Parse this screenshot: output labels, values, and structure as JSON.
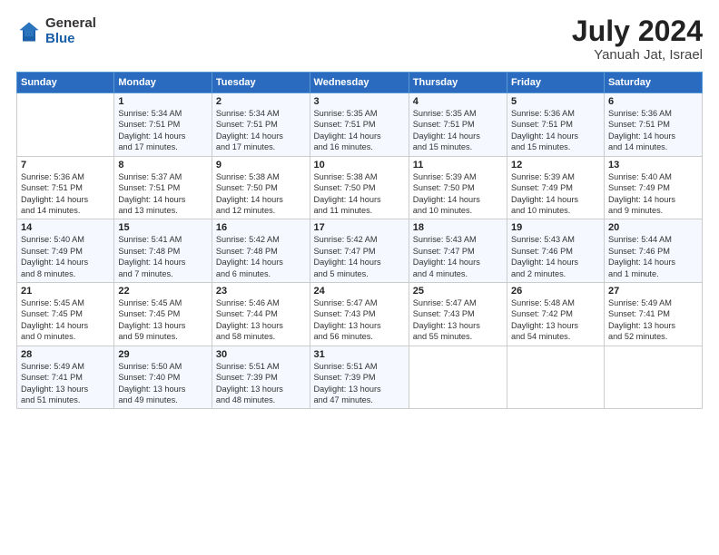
{
  "header": {
    "logo_general": "General",
    "logo_blue": "Blue",
    "title": "July 2024",
    "location": "Yanuah Jat, Israel"
  },
  "days_of_week": [
    "Sunday",
    "Monday",
    "Tuesday",
    "Wednesday",
    "Thursday",
    "Friday",
    "Saturday"
  ],
  "weeks": [
    [
      {
        "day": "",
        "info": ""
      },
      {
        "day": "1",
        "info": "Sunrise: 5:34 AM\nSunset: 7:51 PM\nDaylight: 14 hours\nand 17 minutes."
      },
      {
        "day": "2",
        "info": "Sunrise: 5:34 AM\nSunset: 7:51 PM\nDaylight: 14 hours\nand 17 minutes."
      },
      {
        "day": "3",
        "info": "Sunrise: 5:35 AM\nSunset: 7:51 PM\nDaylight: 14 hours\nand 16 minutes."
      },
      {
        "day": "4",
        "info": "Sunrise: 5:35 AM\nSunset: 7:51 PM\nDaylight: 14 hours\nand 15 minutes."
      },
      {
        "day": "5",
        "info": "Sunrise: 5:36 AM\nSunset: 7:51 PM\nDaylight: 14 hours\nand 15 minutes."
      },
      {
        "day": "6",
        "info": "Sunrise: 5:36 AM\nSunset: 7:51 PM\nDaylight: 14 hours\nand 14 minutes."
      }
    ],
    [
      {
        "day": "7",
        "info": "Sunrise: 5:36 AM\nSunset: 7:51 PM\nDaylight: 14 hours\nand 14 minutes."
      },
      {
        "day": "8",
        "info": "Sunrise: 5:37 AM\nSunset: 7:51 PM\nDaylight: 14 hours\nand 13 minutes."
      },
      {
        "day": "9",
        "info": "Sunrise: 5:38 AM\nSunset: 7:50 PM\nDaylight: 14 hours\nand 12 minutes."
      },
      {
        "day": "10",
        "info": "Sunrise: 5:38 AM\nSunset: 7:50 PM\nDaylight: 14 hours\nand 11 minutes."
      },
      {
        "day": "11",
        "info": "Sunrise: 5:39 AM\nSunset: 7:50 PM\nDaylight: 14 hours\nand 10 minutes."
      },
      {
        "day": "12",
        "info": "Sunrise: 5:39 AM\nSunset: 7:49 PM\nDaylight: 14 hours\nand 10 minutes."
      },
      {
        "day": "13",
        "info": "Sunrise: 5:40 AM\nSunset: 7:49 PM\nDaylight: 14 hours\nand 9 minutes."
      }
    ],
    [
      {
        "day": "14",
        "info": "Sunrise: 5:40 AM\nSunset: 7:49 PM\nDaylight: 14 hours\nand 8 minutes."
      },
      {
        "day": "15",
        "info": "Sunrise: 5:41 AM\nSunset: 7:48 PM\nDaylight: 14 hours\nand 7 minutes."
      },
      {
        "day": "16",
        "info": "Sunrise: 5:42 AM\nSunset: 7:48 PM\nDaylight: 14 hours\nand 6 minutes."
      },
      {
        "day": "17",
        "info": "Sunrise: 5:42 AM\nSunset: 7:47 PM\nDaylight: 14 hours\nand 5 minutes."
      },
      {
        "day": "18",
        "info": "Sunrise: 5:43 AM\nSunset: 7:47 PM\nDaylight: 14 hours\nand 4 minutes."
      },
      {
        "day": "19",
        "info": "Sunrise: 5:43 AM\nSunset: 7:46 PM\nDaylight: 14 hours\nand 2 minutes."
      },
      {
        "day": "20",
        "info": "Sunrise: 5:44 AM\nSunset: 7:46 PM\nDaylight: 14 hours\nand 1 minute."
      }
    ],
    [
      {
        "day": "21",
        "info": "Sunrise: 5:45 AM\nSunset: 7:45 PM\nDaylight: 14 hours\nand 0 minutes."
      },
      {
        "day": "22",
        "info": "Sunrise: 5:45 AM\nSunset: 7:45 PM\nDaylight: 13 hours\nand 59 minutes."
      },
      {
        "day": "23",
        "info": "Sunrise: 5:46 AM\nSunset: 7:44 PM\nDaylight: 13 hours\nand 58 minutes."
      },
      {
        "day": "24",
        "info": "Sunrise: 5:47 AM\nSunset: 7:43 PM\nDaylight: 13 hours\nand 56 minutes."
      },
      {
        "day": "25",
        "info": "Sunrise: 5:47 AM\nSunset: 7:43 PM\nDaylight: 13 hours\nand 55 minutes."
      },
      {
        "day": "26",
        "info": "Sunrise: 5:48 AM\nSunset: 7:42 PM\nDaylight: 13 hours\nand 54 minutes."
      },
      {
        "day": "27",
        "info": "Sunrise: 5:49 AM\nSunset: 7:41 PM\nDaylight: 13 hours\nand 52 minutes."
      }
    ],
    [
      {
        "day": "28",
        "info": "Sunrise: 5:49 AM\nSunset: 7:41 PM\nDaylight: 13 hours\nand 51 minutes."
      },
      {
        "day": "29",
        "info": "Sunrise: 5:50 AM\nSunset: 7:40 PM\nDaylight: 13 hours\nand 49 minutes."
      },
      {
        "day": "30",
        "info": "Sunrise: 5:51 AM\nSunset: 7:39 PM\nDaylight: 13 hours\nand 48 minutes."
      },
      {
        "day": "31",
        "info": "Sunrise: 5:51 AM\nSunset: 7:39 PM\nDaylight: 13 hours\nand 47 minutes."
      },
      {
        "day": "",
        "info": ""
      },
      {
        "day": "",
        "info": ""
      },
      {
        "day": "",
        "info": ""
      }
    ]
  ]
}
